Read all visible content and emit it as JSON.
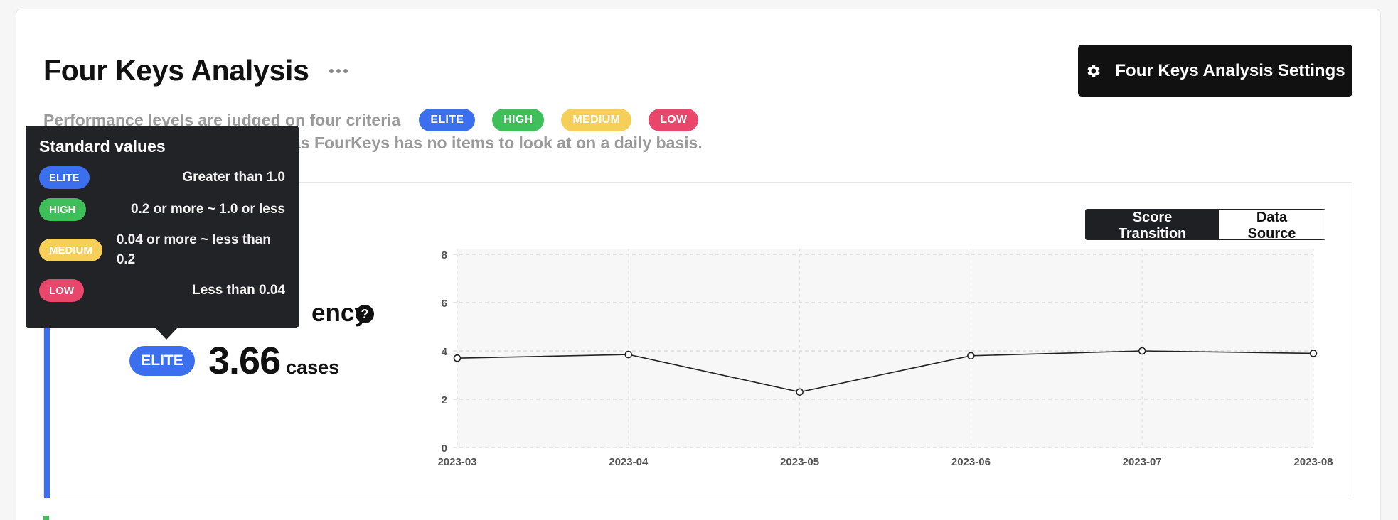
{
  "header": {
    "title": "Four Keys Analysis",
    "settings_label": "Four Keys Analysis Settings"
  },
  "description": {
    "line1": "Performance levels are judged on four criteria",
    "line2": "as FourKeys has no items to look at on a daily basis."
  },
  "levels": {
    "elite": "ELITE",
    "high": "HIGH",
    "medium": "MEDIUM",
    "low": "LOW"
  },
  "tooltip": {
    "title": "Standard values",
    "rows": [
      {
        "level": "ELITE",
        "text": "Greater than 1.0"
      },
      {
        "level": "HIGH",
        "text": "0.2 or more ~ 1.0 or less"
      },
      {
        "level": "MEDIUM",
        "text": "0.04 or more ~ less than 0.2"
      },
      {
        "level": "LOW",
        "text": "Less than 0.04"
      }
    ]
  },
  "metric": {
    "title_visible": "ency",
    "help": "?",
    "level": "ELITE",
    "value": "3.66",
    "unit": "cases"
  },
  "tabs": {
    "score_transition": "Score Transition",
    "data_source": "Data Source"
  },
  "colors": {
    "elite": "#3b6fee",
    "high": "#3fbf5a",
    "medium": "#f6cf58",
    "low": "#e8466b"
  },
  "chart_data": {
    "type": "line",
    "x": [
      "2023-03",
      "2023-04",
      "2023-05",
      "2023-06",
      "2023-07",
      "2023-08"
    ],
    "series": [
      {
        "values": [
          3.7,
          3.85,
          2.3,
          3.8,
          4.0,
          3.9
        ]
      }
    ],
    "yticks": [
      0,
      2,
      4,
      6,
      8
    ],
    "ylim": [
      0,
      8
    ],
    "grid": true
  }
}
